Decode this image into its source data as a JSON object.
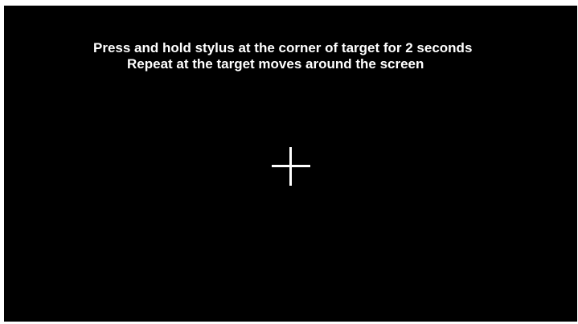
{
  "calibration": {
    "instruction_line_1": "Press and hold stylus at the corner of target for 2 seconds",
    "instruction_line_2": "Repeat at the target moves around the screen",
    "target_icon": "crosshair-icon",
    "background_color": "#000000",
    "text_color": "#ffffff"
  }
}
